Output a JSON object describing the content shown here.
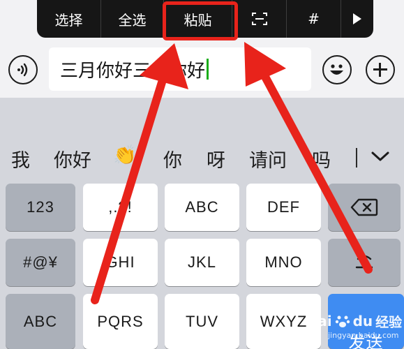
{
  "edit_menu": {
    "items": [
      {
        "label": "选择"
      },
      {
        "label": "全选"
      },
      {
        "label": "粘贴"
      },
      {
        "icon": "scan-text-icon"
      },
      {
        "label": "#"
      },
      {
        "icon": "play-more-icon"
      }
    ]
  },
  "input": {
    "value": "三月你好三月你好"
  },
  "candidates": {
    "items": [
      "我",
      "你好",
      "👏",
      "你",
      "呀",
      "请问",
      "吗"
    ]
  },
  "keyboard": {
    "row1": [
      "123",
      ",.?!",
      "ABC",
      "DEF"
    ],
    "row2": [
      "#@¥",
      "GHI",
      "JKL",
      "MNO"
    ],
    "row3": [
      "ABC",
      "PQRS",
      "TUV",
      "WXYZ"
    ],
    "send": "发送",
    "delete_icon": "backspace-icon",
    "enter_icon": "enter-icon"
  },
  "watermark": {
    "brand": "Bai",
    "brand2": "du",
    "cn": "经验",
    "url": "jingyan.baidu.com"
  },
  "colors": {
    "highlight": "#e8231b",
    "caret": "#1aad19",
    "send_key": "#3f8cf2",
    "menu_bg": "#161616"
  }
}
